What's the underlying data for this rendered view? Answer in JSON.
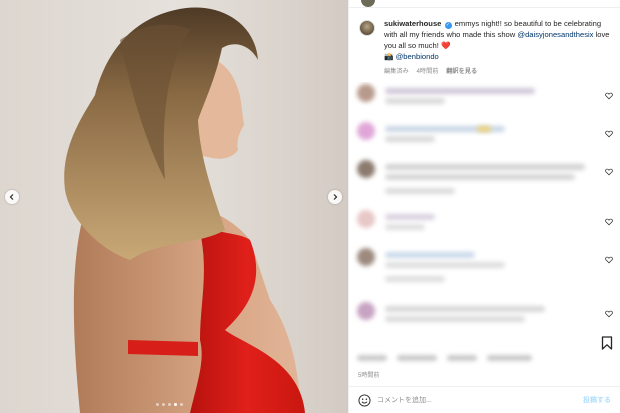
{
  "post": {
    "username": "sukiwaterhouse",
    "caption_body": " emmys night!! so beautiful to be celebrating with all my friends who made this show ",
    "mention_1": "@daisyjonesandthesix",
    "caption_tail": " love you all so much! ",
    "heart_emoji": "❤️",
    "camera_emoji": "📸",
    "mention_2": "@benbiondo",
    "edited_label": "編集済み",
    "age": "4時間前",
    "translate_label": "翻訳を見る",
    "timestamp": "5時間前"
  },
  "comment_box": {
    "placeholder": "コメントを追加...",
    "post_label": "投稿する"
  },
  "carousel": {
    "slide_count": 5,
    "active_index": 3
  },
  "colors": {
    "link": "#00376b",
    "verified": "#3897f0",
    "post_button": "#b2dffc",
    "dress": "#e0201a"
  },
  "icons": {
    "prev": "chevron-left-icon",
    "next": "chevron-right-icon",
    "like": "heart-outline-icon",
    "save": "bookmark-icon",
    "emoji": "smile-icon",
    "verified": "verified-badge-icon"
  }
}
